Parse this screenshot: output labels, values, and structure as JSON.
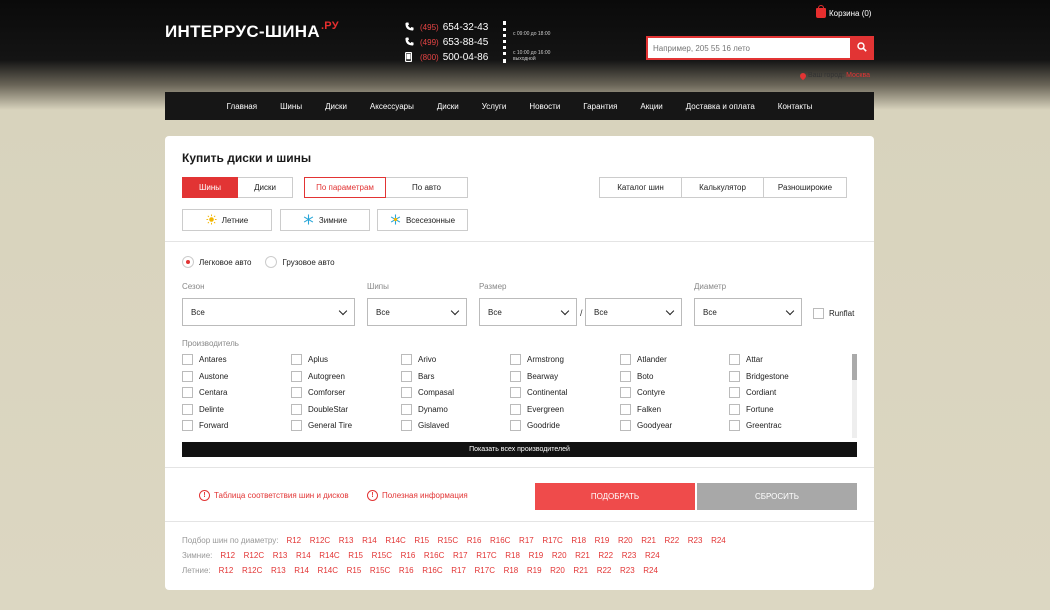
{
  "header": {
    "logo_main": "ИНТЕРРУС-ШИНА",
    "logo_suffix": ".РУ",
    "phones": [
      {
        "code": "(495)",
        "number": "654-32-43"
      },
      {
        "code": "(499)",
        "number": "653-88-45"
      },
      {
        "code": "(800)",
        "number": "500-04-86"
      }
    ],
    "hours_weekdays": "с 09:00 до 18:00",
    "hours_weekend": "с 10:00 до 16:00 выходной",
    "cart_label": "Корзина (0)",
    "search_placeholder": "Например, 205 55 16 лето",
    "city_label": "Ваш город:",
    "city_name": "Москва"
  },
  "nav": [
    "Главная",
    "Шины",
    "Диски",
    "Аксессуары",
    "Диски",
    "Услуги",
    "Новости",
    "Гарантия",
    "Акции",
    "Доставка и оплата",
    "Контакты"
  ],
  "form": {
    "title": "Купить диски и шины",
    "type_tabs": [
      "Шины",
      "Диски"
    ],
    "mode_tabs": [
      "По параметрам",
      "По авто"
    ],
    "tools": [
      "Каталог шин",
      "Калькулятор",
      "Разноширокие"
    ],
    "seasons": [
      "Летние",
      "Зимние",
      "Всесезонные"
    ],
    "vehicle": [
      "Легковое авто",
      "Грузовое авто"
    ],
    "labels": {
      "season": "Сезон",
      "spikes": "Шипы",
      "size": "Размер",
      "diameter": "Диаметр",
      "manufacturer": "Производитель"
    },
    "select_default": "Все",
    "runflat": "Runflat",
    "brands": [
      [
        "Antares",
        "Austone",
        "Centara",
        "Delinte",
        "Forward"
      ],
      [
        "Aplus",
        "Autogreen",
        "Comforser",
        "DoubleStar",
        "General Tire"
      ],
      [
        "Arivo",
        "Bars",
        "Compasal",
        "Dynamo",
        "Gislaved"
      ],
      [
        "Armstrong",
        "Bearway",
        "Continental",
        "Evergreen",
        "Goodride"
      ],
      [
        "Atlander",
        "Boto",
        "Contyre",
        "Falken",
        "Goodyear"
      ],
      [
        "Attar",
        "Bridgestone",
        "Cordiant",
        "Fortune",
        "Greentrac"
      ]
    ],
    "show_all": "Показать всех производителей",
    "link_table": "Таблица соответствия шин и дисков",
    "link_info": "Полезная информация",
    "submit": "ПОДОБРАТЬ",
    "reset": "СБРОСИТЬ"
  },
  "quick": {
    "row1_label": "Подбор шин по диаметру:",
    "row2_label": "Зимние:",
    "row3_label": "Летние:",
    "sizes": [
      "R12",
      "R12C",
      "R13",
      "R14",
      "R14C",
      "R15",
      "R15C",
      "R16",
      "R16C",
      "R17",
      "R17C",
      "R18",
      "R19",
      "R20",
      "R21",
      "R22",
      "R23",
      "R24"
    ]
  },
  "colors": {
    "accent": "#e23434",
    "submit": "#ef4b4b",
    "reset": "#a8a8a8",
    "nav_bg": "#161616"
  }
}
